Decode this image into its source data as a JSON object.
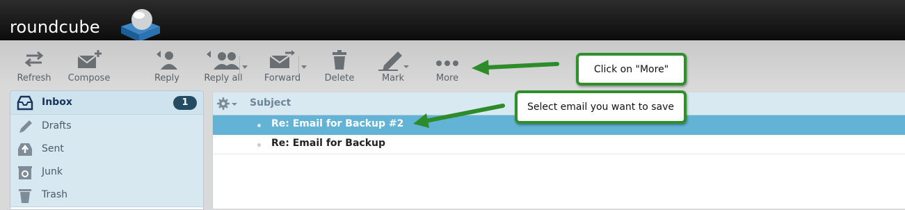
{
  "app": {
    "logo_text": "roundcube"
  },
  "toolbar": {
    "refresh": "Refresh",
    "compose": "Compose",
    "reply": "Reply",
    "reply_all": "Reply all",
    "forward": "Forward",
    "delete": "Delete",
    "mark": "Mark",
    "more": "More"
  },
  "folders": [
    {
      "name": "Inbox",
      "icon": "inbox-icon",
      "unread": "1",
      "selected": true
    },
    {
      "name": "Drafts",
      "icon": "pencil-icon"
    },
    {
      "name": "Sent",
      "icon": "sent-icon"
    },
    {
      "name": "Junk",
      "icon": "junk-icon"
    },
    {
      "name": "Trash",
      "icon": "trash-icon"
    }
  ],
  "message_list": {
    "column_subject": "Subject",
    "rows": [
      {
        "subject": "Re: Email for Backup #2",
        "selected": true
      },
      {
        "subject": "Re: Email for Backup",
        "selected": false
      }
    ]
  },
  "annotations": {
    "callout_more": "Click on \"More\"",
    "callout_select": "Select email you want to save"
  },
  "colors": {
    "header": "#1a1a1a",
    "selected_row": "#62b3d6",
    "folder_bg": "#d7e8f0",
    "unread_badge": "#234c63",
    "callout_border": "#2f8f2a"
  }
}
